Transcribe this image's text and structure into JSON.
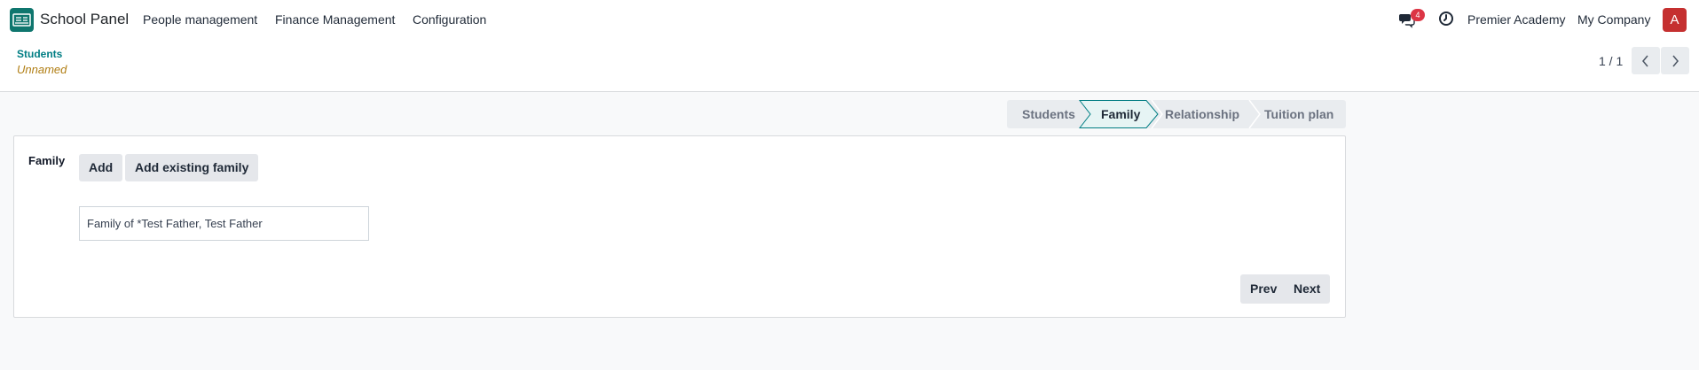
{
  "navbar": {
    "app_name": "School Panel",
    "menu": [
      "People management",
      "Finance Management",
      "Configuration"
    ],
    "chat_badge": "4",
    "company_active": "Premier Academy",
    "company_main": "My Company",
    "avatar_letter": "A"
  },
  "control_panel": {
    "breadcrumb": "Students",
    "record_name": "Unnamed",
    "pager": "1 / 1"
  },
  "steps": {
    "items": [
      "Students",
      "Family",
      "Relationship",
      "Tuition plan"
    ],
    "active": "Family"
  },
  "form": {
    "family_label": "Family",
    "add_label": "Add",
    "add_existing_label": "Add existing family",
    "family_value": "Family of *Test Father, Test Father",
    "prev_label": "Prev",
    "next_label": "Next"
  },
  "colors": {
    "accent": "#017e84",
    "record_name": "#b07d12",
    "badge": "#dc3545",
    "avatar": "#c53030",
    "logo": "#0f766e"
  },
  "icons": [
    "app-logo-icon",
    "chat-icon",
    "clock-icon",
    "chevron-left-icon",
    "chevron-right-icon"
  ]
}
